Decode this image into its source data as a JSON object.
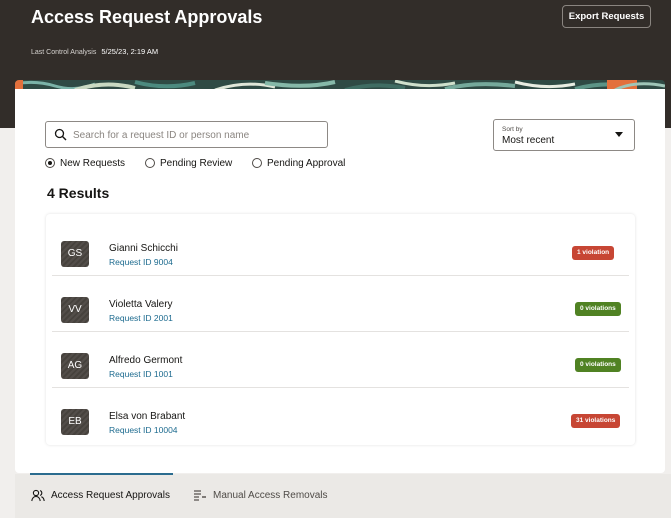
{
  "header": {
    "title": "Access Request Approvals",
    "export_label": "Export Requests",
    "last_analysis_label": "Last Control Analysis",
    "last_analysis_value": "5/25/23, 2:19 AM"
  },
  "search": {
    "placeholder": "Search for a request ID or person name",
    "value": "",
    "icon": "search-icon"
  },
  "sort": {
    "label": "Sort by",
    "value": "Most recent",
    "icon": "chevron-down-icon"
  },
  "filters": [
    {
      "label": "New Requests",
      "selected": true
    },
    {
      "label": "Pending Review",
      "selected": false
    },
    {
      "label": "Pending Approval",
      "selected": false
    }
  ],
  "results_label": "4 Results",
  "requests": [
    {
      "initials": "GS",
      "name": "Gianni Schicchi",
      "request_id": "Request ID 9004",
      "violations": "1 violation",
      "status": "violation"
    },
    {
      "initials": "VV",
      "name": "Violetta Valery",
      "request_id": "Request ID 2001",
      "violations": "0 violations",
      "status": "clear"
    },
    {
      "initials": "AG",
      "name": "Alfredo Germont",
      "request_id": "Request ID 1001",
      "violations": "0 violations",
      "status": "clear"
    },
    {
      "initials": "EB",
      "name": "Elsa von Brabant",
      "request_id": "Request ID 10004",
      "violations": "31 violations",
      "status": "violation"
    }
  ],
  "tabs": [
    {
      "label": "Access Request Approvals",
      "icon": "users-icon",
      "active": true
    },
    {
      "label": "Manual Access Removals",
      "icon": "list-remove-icon",
      "active": false
    }
  ],
  "colors": {
    "header_bg": "#322d29",
    "violation": "#c74634",
    "clear": "#508223",
    "link": "#1d6b8f",
    "tab_accent": "#2b6c8f"
  }
}
